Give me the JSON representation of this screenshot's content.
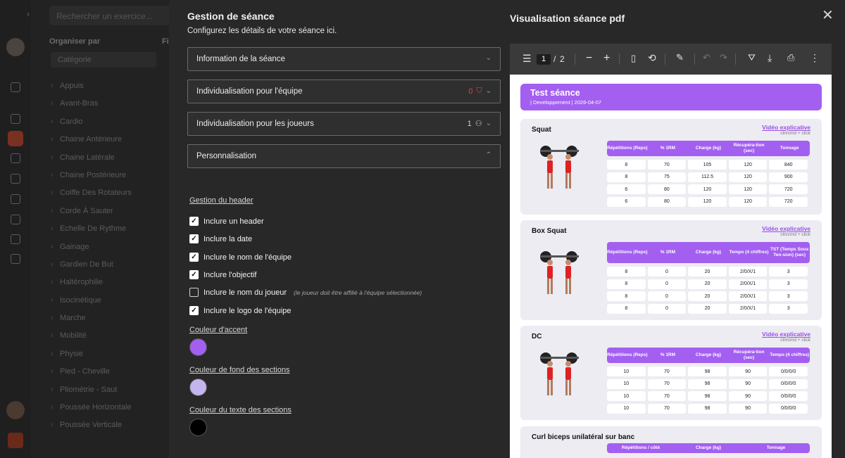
{
  "background": {
    "search_placeholder": "Rechercher un exercice...",
    "organize_label": "Organiser par",
    "filter_label_partial": "Fi",
    "select_value": "Catégorie",
    "categories": [
      "Appuis",
      "Avant-Bras",
      "Cardio",
      "Chaine Antérieure",
      "Chaine Latérale",
      "Chaine Postérieure",
      "Coiffe Des Rotateurs",
      "Corde À Sauter",
      "Echelle De Rythme",
      "Gainage",
      "Gardien De But",
      "Haltérophilie",
      "Isocinétique",
      "Marche",
      "Mobilité",
      "Physie",
      "Pied - Cheville",
      "Pliométrie - Saut",
      "Poussée Horizontale",
      "Poussée Verticale"
    ]
  },
  "left_panel": {
    "title": "Gestion de séance",
    "subtitle": "Configurez les détails de votre séance ici.",
    "accordions": [
      {
        "label": "Information de la séance",
        "badge": "",
        "expanded": false
      },
      {
        "label": "Individualisation pour l'équipe",
        "badge": "0",
        "expanded": false
      },
      {
        "label": "Individualisation pour les joueurs",
        "badge": "1",
        "expanded": false
      },
      {
        "label": "Personnalisation",
        "badge": "",
        "expanded": true
      }
    ],
    "header_section": "Gestion du header",
    "checkboxes": [
      {
        "label": "Inclure un header",
        "checked": true,
        "hint": ""
      },
      {
        "label": "Inclure la date",
        "checked": true,
        "hint": ""
      },
      {
        "label": "Inclure le nom de l'équipe",
        "checked": true,
        "hint": ""
      },
      {
        "label": "Inclure l'objectif",
        "checked": true,
        "hint": ""
      },
      {
        "label": "Inclure le nom du joueur",
        "checked": false,
        "hint": "(le joueur doit être affilié à l'équipe sélectionnée)"
      },
      {
        "label": "Inclure le logo de l'équipe",
        "checked": true,
        "hint": ""
      }
    ],
    "colors": [
      {
        "label": "Couleur d'accent",
        "value": "#a35ff0"
      },
      {
        "label": "Couleur de fond des sections",
        "value": "#c4b5ee"
      },
      {
        "label": "Couleur du texte des sections",
        "value": "#000000"
      }
    ]
  },
  "right_panel": {
    "title": "Visualisation séance pdf",
    "toolbar": {
      "page": "1",
      "separator": "/",
      "total": "2"
    },
    "pdf": {
      "title": "Test séance",
      "meta": "| Developpement | 2026-04-07",
      "video_label": "Vidéo explicative",
      "video_hint": "ctrl/cmd + click",
      "exercises": [
        {
          "name": "Squat",
          "headers": [
            "Répétitions (Reps)",
            "% 1RM",
            "Charge (kg)",
            "Récupéra-tion (sec)",
            "Tonnage"
          ],
          "rows": [
            [
              "8",
              "70",
              "105",
              "120",
              "840"
            ],
            [
              "8",
              "75",
              "112.5",
              "120",
              "900"
            ],
            [
              "6",
              "80",
              "120",
              "120",
              "720"
            ],
            [
              "6",
              "80",
              "120",
              "120",
              "720"
            ]
          ]
        },
        {
          "name": "Box Squat",
          "headers": [
            "Répétitions (Reps)",
            "% 1RM",
            "Charge (kg)",
            "Tempo (4 chiffres)",
            "TST (Temps Sous Ten-sion) (sec)"
          ],
          "rows": [
            [
              "8",
              "0",
              "20",
              "2/0/X/1",
              "3"
            ],
            [
              "8",
              "0",
              "20",
              "2/0/X/1",
              "3"
            ],
            [
              "8",
              "0",
              "20",
              "2/0/X/1",
              "3"
            ],
            [
              "8",
              "0",
              "20",
              "2/0/X/1",
              "3"
            ]
          ]
        },
        {
          "name": "DC",
          "headers": [
            "Répétitions (Reps)",
            "% 1RM",
            "Charge (kg)",
            "Récupéra-tion (sec)",
            "Tempo (4 chiffres)"
          ],
          "rows": [
            [
              "10",
              "70",
              "98",
              "90",
              "0/0/0/0"
            ],
            [
              "10",
              "70",
              "98",
              "90",
              "0/0/0/0"
            ],
            [
              "10",
              "70",
              "98",
              "90",
              "0/0/0/0"
            ],
            [
              "10",
              "70",
              "98",
              "90",
              "0/0/0/0"
            ]
          ]
        },
        {
          "name": "Curl biceps unilatéral sur banc",
          "headers": [
            "Répétitions / côté",
            "Charge (kg)",
            "Tonnage"
          ],
          "rows": []
        }
      ]
    }
  },
  "colors": {
    "accent": "#a35ff0",
    "danger": "#e2472d"
  }
}
